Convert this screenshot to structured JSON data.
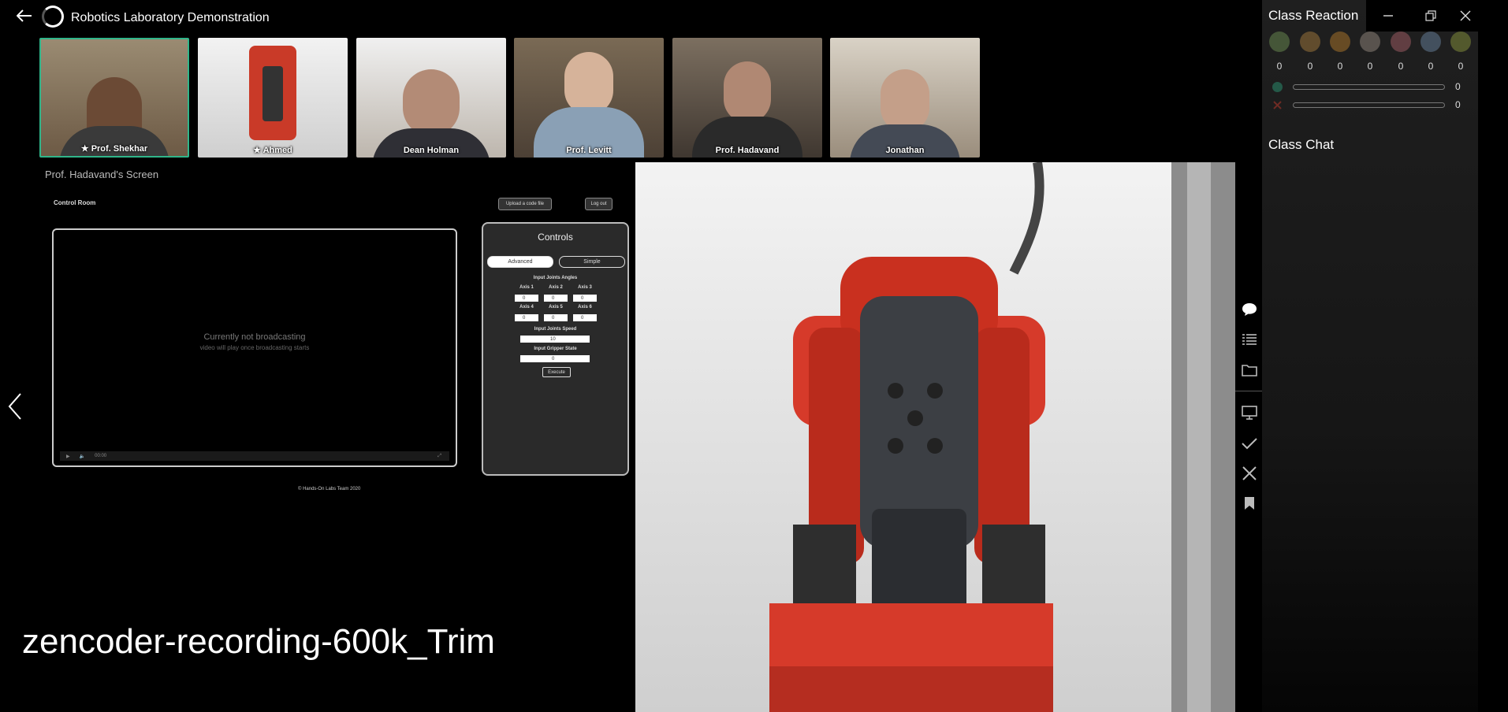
{
  "app": {
    "title": "Robotics Laboratory Demonstration"
  },
  "participants": [
    {
      "name": "Prof. Shekhar",
      "starred": true,
      "active": true
    },
    {
      "name": "Ahmed",
      "starred": true,
      "active": false
    },
    {
      "name": "Dean Holman",
      "starred": false,
      "active": false
    },
    {
      "name": "Prof. Levitt",
      "starred": false,
      "active": false
    },
    {
      "name": "Prof. Hadavand",
      "starred": false,
      "active": false
    },
    {
      "name": "Jonathan",
      "starred": false,
      "active": false
    }
  ],
  "screen_share": {
    "label": "Prof. Hadavand's Screen",
    "page_title": "Control Room",
    "upload_button": "Upload a code file",
    "logout_button": "Log out",
    "video_status": "Currently not broadcasting",
    "video_substatus": "video will play once broadcasting starts",
    "video_time": "00:00",
    "controls": {
      "title": "Controls",
      "tab_advanced": "Advanced",
      "tab_simple": "Simple",
      "joints_label": "Input Joints Angles",
      "axes": [
        {
          "label": "Axis 1",
          "value": "0"
        },
        {
          "label": "Axis 2",
          "value": "0"
        },
        {
          "label": "Axis 3",
          "value": "0"
        },
        {
          "label": "Axis 4",
          "value": "0"
        },
        {
          "label": "Axis 5",
          "value": "0"
        },
        {
          "label": "Axis 6",
          "value": "0"
        }
      ],
      "speed_label": "Input Joints Speed",
      "speed_value": "10",
      "gripper_label": "Input Gripper State",
      "gripper_value": "0",
      "execute_button": "Execute"
    },
    "footer": "© Hands-On Labs Team 2020"
  },
  "recording_name": "zencoder-recording-600k_Trim",
  "reactions": {
    "title": "Class Reaction",
    "emoji_icons": [
      "smile-emoji-icon",
      "neutral-emoji-icon",
      "thumbs-emoji-icon",
      "confused-emoji-icon",
      "laugh-emoji-icon",
      "surprised-emoji-icon",
      "clap-emoji-icon"
    ],
    "counts": [
      "0",
      "0",
      "0",
      "0",
      "0",
      "0",
      "0"
    ],
    "yes_count": "0",
    "no_count": "0",
    "yes_fraction": 0,
    "no_fraction": 0
  },
  "chat": {
    "title": "Class Chat"
  },
  "colors": {
    "active_border": "#2fb58a",
    "yes": "#2fb58a",
    "no": "#c0392b",
    "robot_red": "#d63a2a"
  }
}
